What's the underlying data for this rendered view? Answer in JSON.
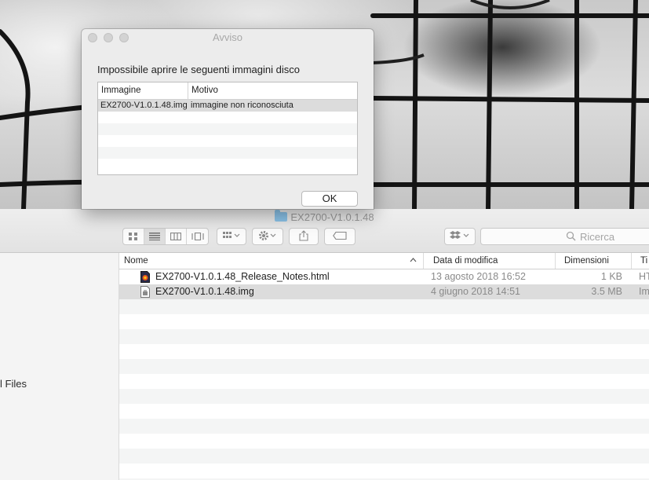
{
  "alert": {
    "title": "Avviso",
    "message": "Impossibile aprire le seguenti immagini disco",
    "columns": [
      "Immagine",
      "Motivo"
    ],
    "rows": [
      {
        "image": "EX2700-V1.0.1.48.img",
        "reason": "immagine non riconosciuta"
      }
    ],
    "ok_label": "OK"
  },
  "finder": {
    "title": "EX2700-V1.0.1.48",
    "search_placeholder": "Ricerca",
    "icons": {
      "view_icons": "grid-icon",
      "view_list": "list-icon",
      "view_columns": "columns-icon",
      "view_coverflow": "coverflow-icon",
      "arrange": "arrange-icon",
      "action": "gear-icon",
      "share": "share-icon",
      "tags": "tag-icon",
      "dropbox": "dropbox-icon",
      "search": "search-icon"
    },
    "sidebar": {
      "files_label": "l Files"
    },
    "columns": {
      "name": "Nome",
      "date": "Data di modifica",
      "size": "Dimensioni",
      "type": "Ti"
    },
    "files": [
      {
        "name": "EX2700-V1.0.1.48_Release_Notes.html",
        "date": "13 agosto 2018 16:52",
        "size": "1 KB",
        "type": "HT"
      },
      {
        "name": "EX2700-V1.0.1.48.img",
        "date": "4 giugno 2018 14:51",
        "size": "3.5 MB",
        "type": "Im"
      }
    ]
  }
}
